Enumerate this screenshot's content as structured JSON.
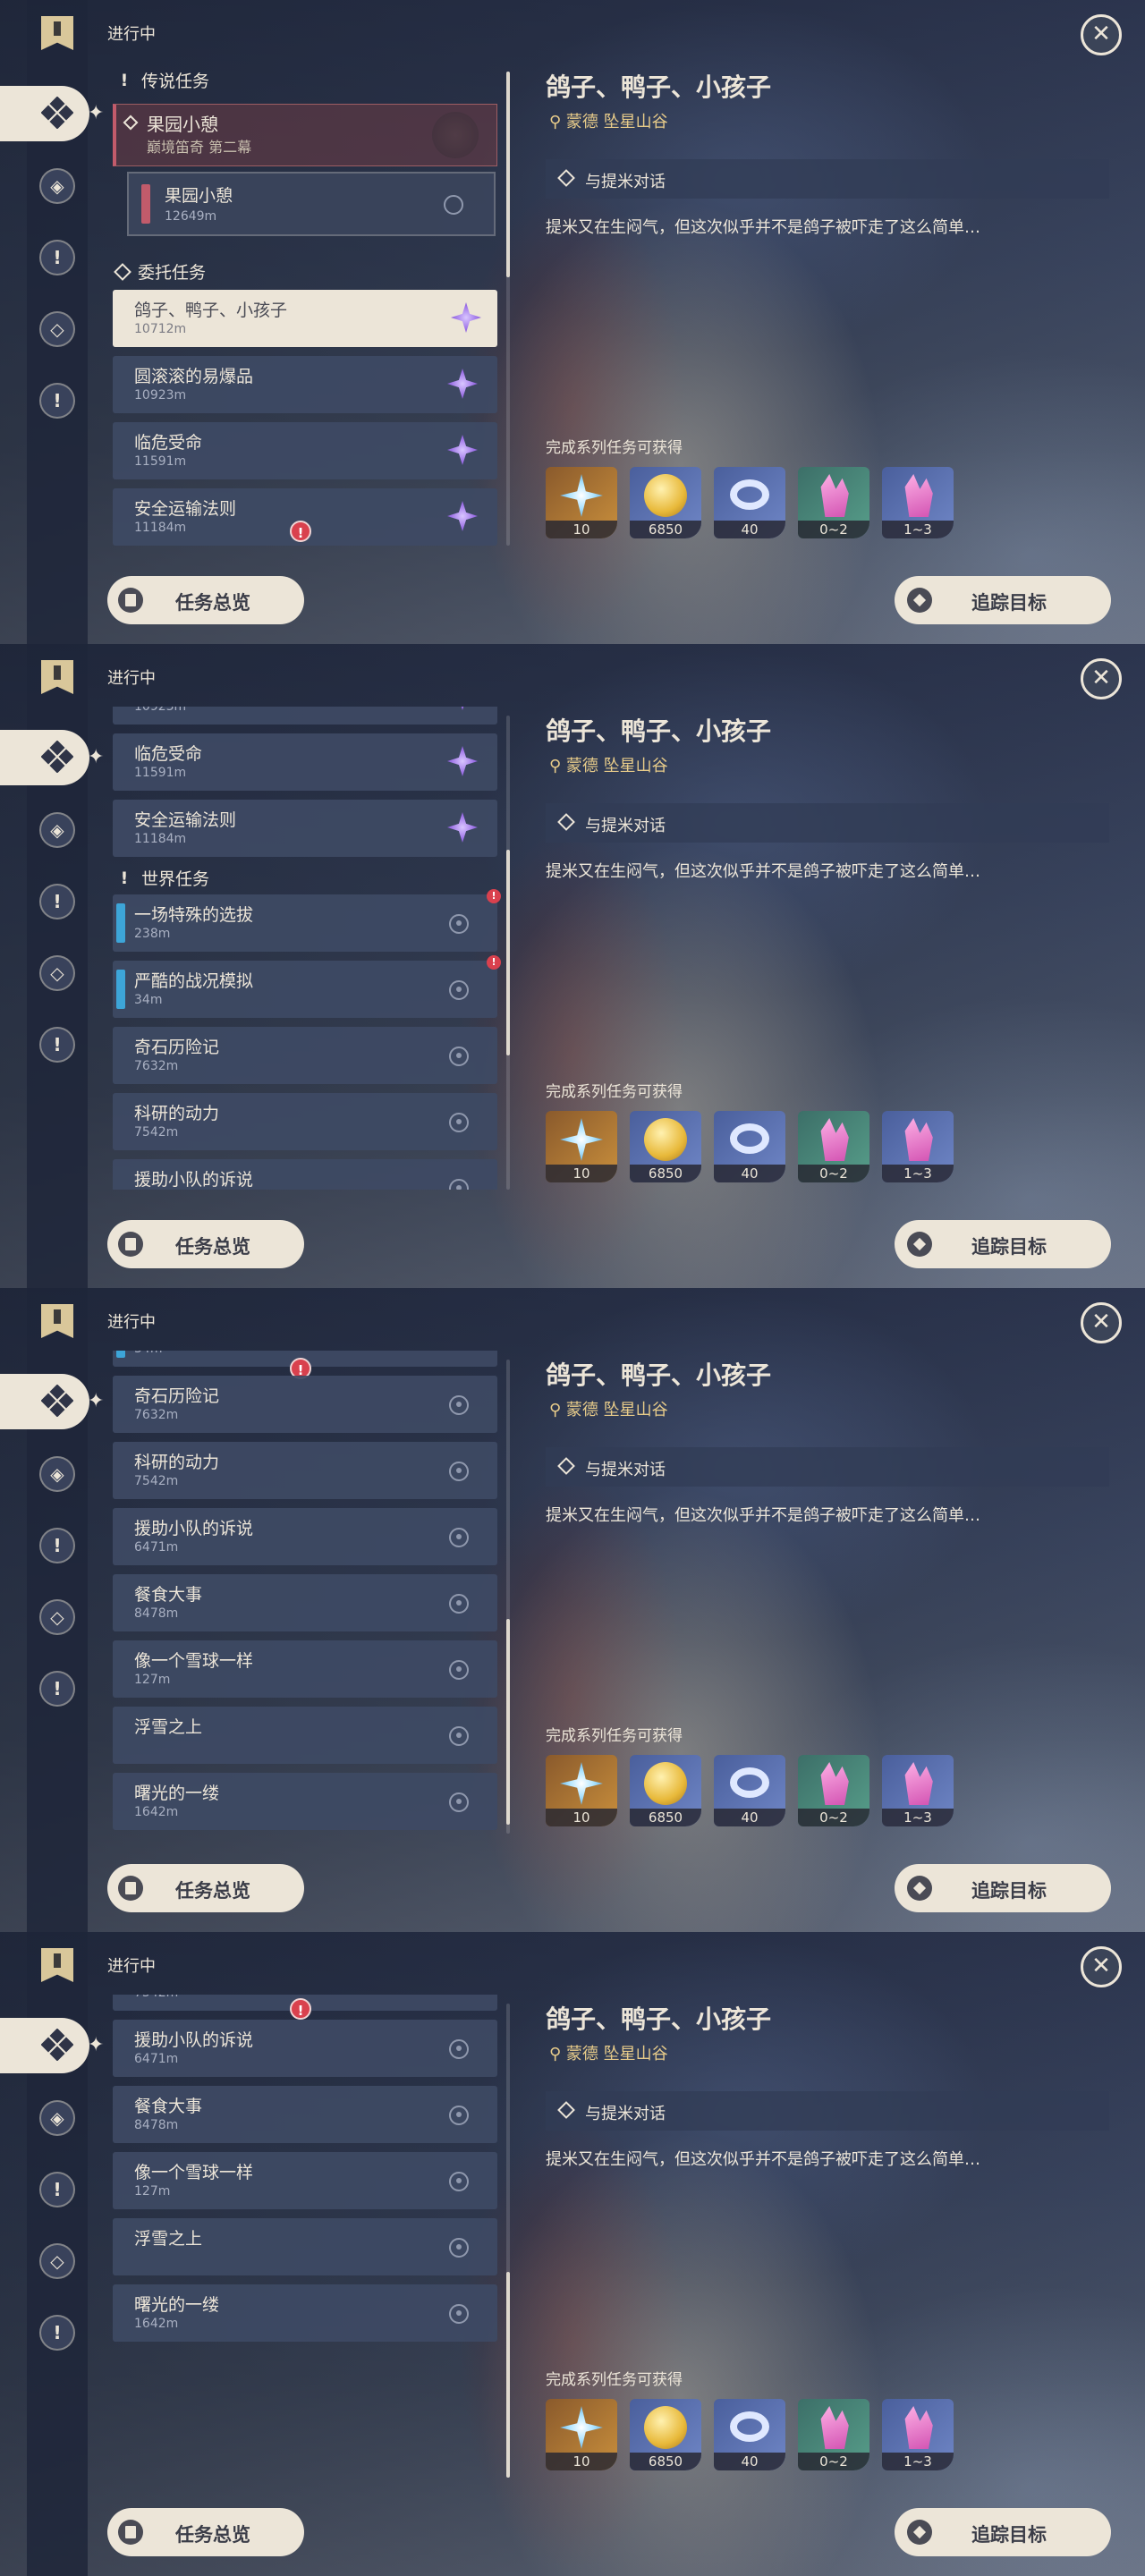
{
  "header": {
    "in_progress": "进行中",
    "close_symbol": "✕"
  },
  "sidebar": {
    "icons": [
      "bookmark-icon",
      "all-quests-icon",
      "archon-quest-icon",
      "story-quest-icon",
      "commission-quest-icon",
      "world-quest-icon"
    ]
  },
  "sections": {
    "legend": "传说任务",
    "commission": "委托任务",
    "world": "世界任务"
  },
  "legend_quest": {
    "title": "果园小憩",
    "chapter": "巅境笛奇 第二幕",
    "sub_title": "果园小憩",
    "sub_distance": "12649m"
  },
  "quests": {
    "q1": {
      "title": "鸽子、鸭子、小孩子",
      "distance": "10712m"
    },
    "q2": {
      "title": "圆滚滚的易爆品",
      "distance": "10923m"
    },
    "q3": {
      "title": "临危受命",
      "distance": "11591m"
    },
    "q4": {
      "title": "安全运输法则",
      "distance": "11184m"
    },
    "w1": {
      "title": "一场特殊的选拔",
      "distance": "238m"
    },
    "w2": {
      "title": "严酷的战况模拟",
      "distance": "34m"
    },
    "w3": {
      "title": "奇石历险记",
      "distance": "7632m"
    },
    "w4": {
      "title": "科研的动力",
      "distance": "7542m"
    },
    "w5": {
      "title": "援助小队的诉说",
      "distance": "6471m"
    },
    "w6": {
      "title": "餐食大事",
      "distance": "8478m"
    },
    "w7": {
      "title": "像一个雪球一样",
      "distance": "127m"
    },
    "w8": {
      "title": "浮雪之上",
      "distance": ""
    },
    "w9": {
      "title": "曙光的一缕",
      "distance": "1642m"
    }
  },
  "detail": {
    "title": "鸽子、鸭子、小孩子",
    "location": "蒙德 坠星山谷",
    "objective": "与提米对话",
    "description": "提米又在生闷气，但这次似乎并不是鸽子被吓走了这么简单…",
    "rewards_label": "完成系列任务可获得",
    "rewards": [
      {
        "icon": "primogem-icon",
        "count": "10"
      },
      {
        "icon": "mora-icon",
        "count": "6850"
      },
      {
        "icon": "adventure-exp-icon",
        "count": "40"
      },
      {
        "icon": "green-crystal-icon",
        "count": "0~2"
      },
      {
        "icon": "pink-crystal-icon",
        "count": "1~3"
      }
    ]
  },
  "buttons": {
    "overview": "任务总览",
    "track": "追踪目标"
  }
}
